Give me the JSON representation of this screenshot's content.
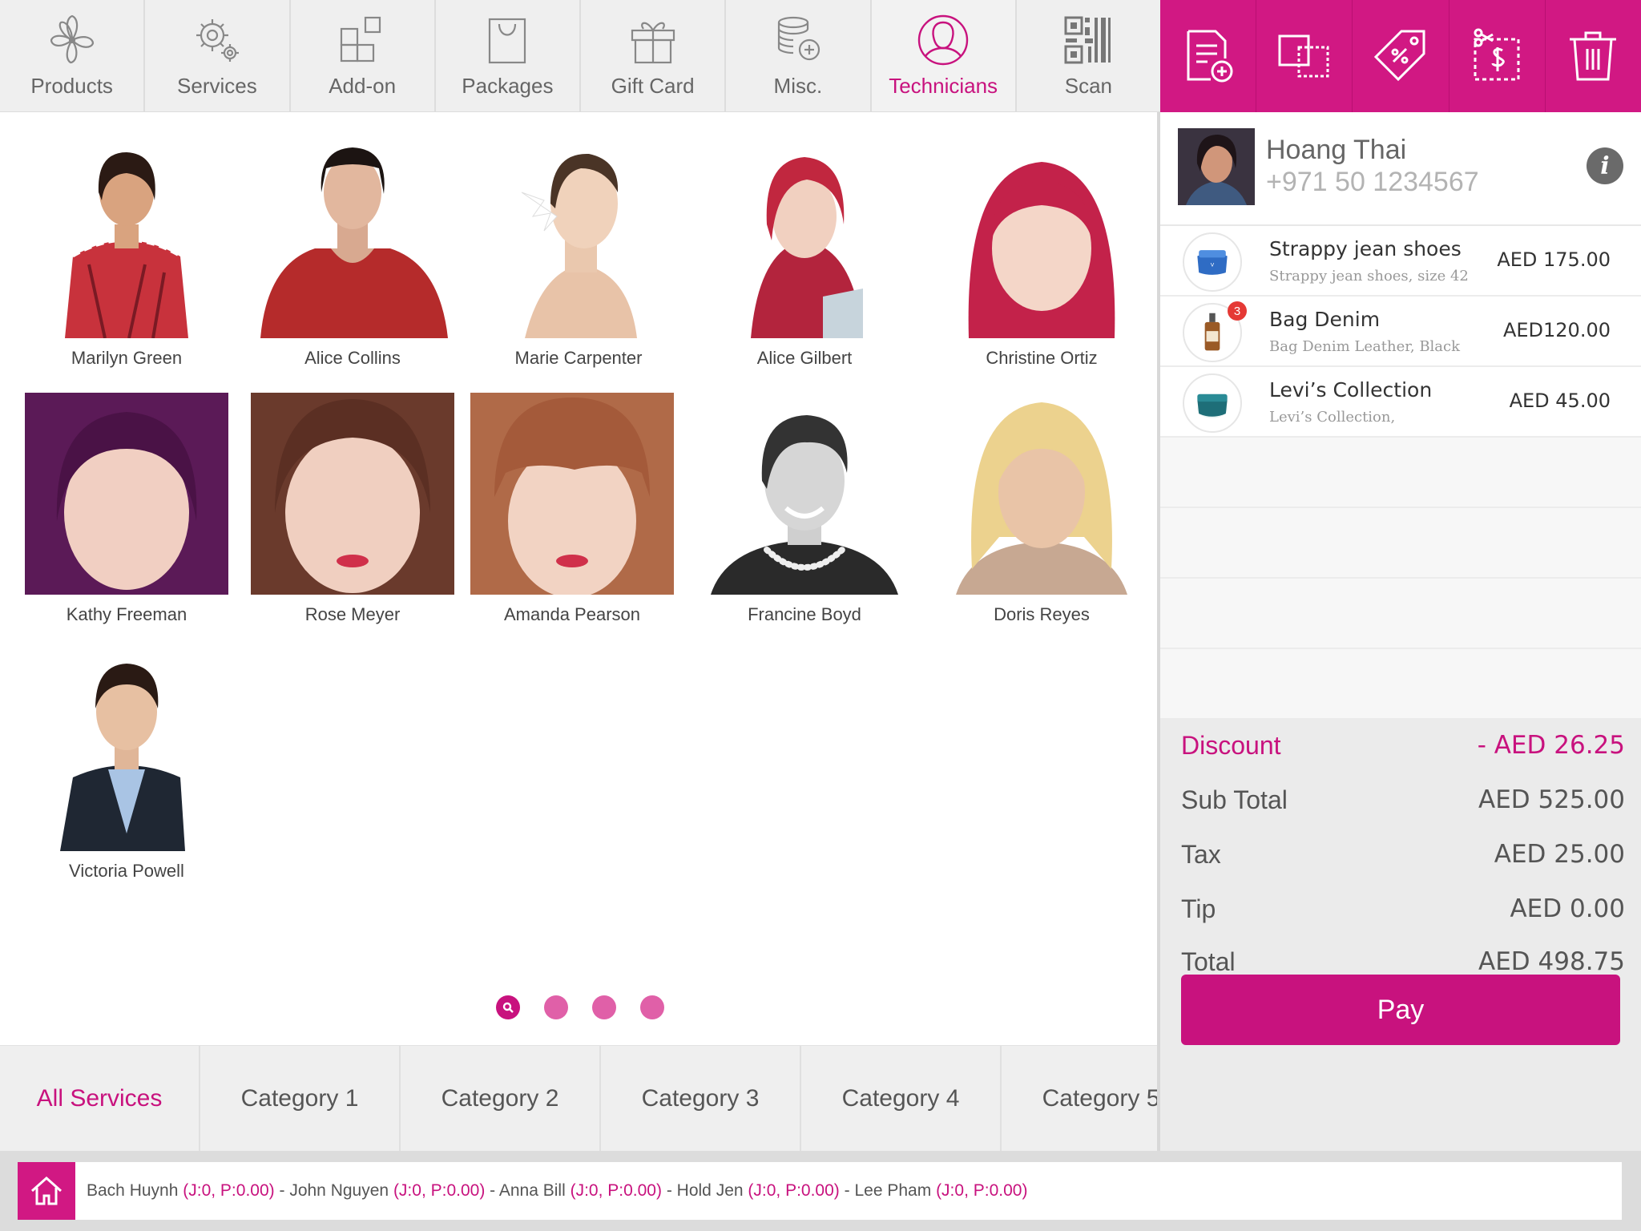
{
  "tabs": [
    {
      "label": "Products",
      "icon": "flower-icon"
    },
    {
      "label": "Services",
      "icon": "gears-icon"
    },
    {
      "label": "Add-on",
      "icon": "addon-blocks-icon"
    },
    {
      "label": "Packages",
      "icon": "bag-icon"
    },
    {
      "label": "Gift Card",
      "icon": "gift-icon"
    },
    {
      "label": "Misc.",
      "icon": "coins-icon"
    },
    {
      "label": "Technicians",
      "icon": "person-icon",
      "active": true
    },
    {
      "label": "Scan",
      "icon": "qr-code-icon"
    }
  ],
  "actions": [
    "new-ticket-icon",
    "split-ticket-icon",
    "discount-tag-icon",
    "service-price-icon",
    "trash-icon"
  ],
  "technicians": [
    {
      "name": "Marilyn Green"
    },
    {
      "name": "Alice Collins"
    },
    {
      "name": "Marie Carpenter"
    },
    {
      "name": "Alice Gilbert"
    },
    {
      "name": "Christine Ortiz"
    },
    {
      "name": "Kathy Freeman"
    },
    {
      "name": "Rose Meyer"
    },
    {
      "name": "Amanda Pearson"
    },
    {
      "name": "Francine Boyd"
    },
    {
      "name": "Doris Reyes"
    },
    {
      "name": "Victoria Powell"
    }
  ],
  "categories": [
    {
      "label": "All Services",
      "active": true
    },
    {
      "label": "Category 1"
    },
    {
      "label": "Category 2"
    },
    {
      "label": "Category 3"
    },
    {
      "label": "Category 4"
    },
    {
      "label": "Category 5"
    }
  ],
  "customer": {
    "name": "Hoang Thai",
    "phone": "+971 50 1234567",
    "info_label": "i"
  },
  "cart": [
    {
      "name": "Strappy jean shoes",
      "desc": "Strappy jean shoes, size 42",
      "price": "AED 175.00"
    },
    {
      "name": "Bag Denim",
      "desc": "Bag Denim Leather, Black",
      "price": "AED120.00",
      "badge": "3"
    },
    {
      "name": "Levi’s Collection",
      "desc": "Levi’s Collection,",
      "price": "AED 45.00"
    }
  ],
  "totals": {
    "discount_label": "Discount",
    "discount_value": "- AED 26.25",
    "subtotal_label": "Sub Total",
    "subtotal_value": "AED 525.00",
    "tax_label": "Tax",
    "tax_value": "AED 25.00",
    "tip_label": "Tip",
    "tip_value": "AED 0.00",
    "total_label": "Total",
    "total_value": "AED 498.75"
  },
  "pay_label": "Pay",
  "queue": [
    {
      "name": "Bach Huynh",
      "stat": "(J:0, P:0.00)"
    },
    {
      "name": "John Nguyen",
      "stat": "(J:0, P:0.00)"
    },
    {
      "name": "Anna Bill",
      "stat": "(J:0, P:0.00)"
    },
    {
      "name": "Hold Jen",
      "stat": "(J:0, P:0.00)"
    },
    {
      "name": "Lee Pham",
      "stat": "(J:0, P:0.00)"
    }
  ],
  "colors": {
    "accent": "#c8127e",
    "action_bar": "#d11883"
  }
}
